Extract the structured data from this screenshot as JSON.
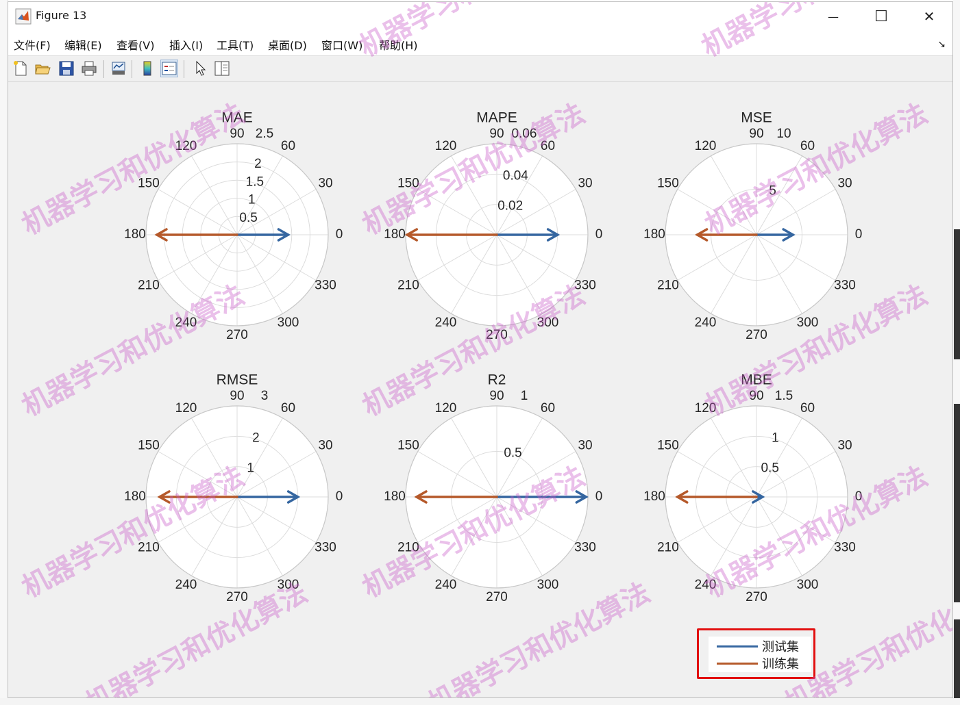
{
  "window": {
    "title": "Figure 13",
    "controls": {
      "minimize": "—",
      "maximize": "☐",
      "close": "✕"
    }
  },
  "menubar": {
    "items": [
      "文件(F)",
      "编辑(E)",
      "查看(V)",
      "插入(I)",
      "工具(T)",
      "桌面(D)",
      "窗口(W)",
      "帮助(H)"
    ],
    "overflow": "↘"
  },
  "toolbar": {
    "buttons": [
      {
        "name": "new-figure",
        "icon": "new-file-icon"
      },
      {
        "name": "open-file",
        "icon": "folder-open-icon"
      },
      {
        "name": "save-figure",
        "icon": "save-icon"
      },
      {
        "name": "print-figure",
        "icon": "printer-icon"
      },
      {
        "name": "link-plot",
        "icon": "link-plot-icon"
      },
      {
        "name": "insert-colorbar",
        "icon": "colorbar-icon"
      },
      {
        "name": "insert-legend",
        "icon": "legend-icon"
      },
      {
        "name": "edit-plot",
        "icon": "cursor-arrow-icon"
      },
      {
        "name": "property-inspector",
        "icon": "panel-icon"
      }
    ]
  },
  "colors": {
    "test": "#3566a0",
    "train": "#b5592a",
    "legend_border": "#e21010"
  },
  "legend": {
    "test_label": "测试集",
    "train_label": "训练集"
  },
  "watermark_text": "机器学习和优化算法",
  "angle_labels": [
    "0",
    "30",
    "60",
    "90",
    "120",
    "150",
    "180",
    "210",
    "240",
    "270",
    "300",
    "330"
  ],
  "chart_data": [
    {
      "type": "polar",
      "title": "MAE",
      "rmax": 2.5,
      "rticks": [
        "0.5",
        "1",
        "1.5",
        "2",
        "2.5"
      ],
      "series": [
        {
          "name": "测试集",
          "theta": 0,
          "r": 1.4
        },
        {
          "name": "训练集",
          "theta": 180,
          "r": 2.2
        }
      ]
    },
    {
      "type": "polar",
      "title": "MAPE",
      "rmax": 0.06,
      "rticks": [
        "0.02",
        "0.04",
        "0.06"
      ],
      "series": [
        {
          "name": "测试集",
          "theta": 0,
          "r": 0.04
        },
        {
          "name": "训练集",
          "theta": 180,
          "r": 0.059
        }
      ]
    },
    {
      "type": "polar",
      "title": "MSE",
      "rmax": 10,
      "rticks": [
        "5",
        "10"
      ],
      "series": [
        {
          "name": "测试集",
          "theta": 0,
          "r": 4.0
        },
        {
          "name": "训练集",
          "theta": 180,
          "r": 6.5
        }
      ]
    },
    {
      "type": "polar",
      "title": "RMSE",
      "rmax": 3,
      "rticks": [
        "1",
        "2",
        "3"
      ],
      "series": [
        {
          "name": "测试集",
          "theta": 0,
          "r": 2.0
        },
        {
          "name": "训练集",
          "theta": 180,
          "r": 2.55
        }
      ]
    },
    {
      "type": "polar",
      "title": "R2",
      "rmax": 1,
      "rticks": [
        "0.5",
        "1"
      ],
      "series": [
        {
          "name": "测试集",
          "theta": 0,
          "r": 0.98
        },
        {
          "name": "训练集",
          "theta": 180,
          "r": 0.88
        }
      ]
    },
    {
      "type": "polar",
      "title": "MBE",
      "rmax": 1.5,
      "rticks": [
        "0.5",
        "1",
        "1.5"
      ],
      "series": [
        {
          "name": "测试集",
          "theta": 0,
          "r": 0.1
        },
        {
          "name": "训练集",
          "theta": 180,
          "r": 1.3
        }
      ]
    }
  ]
}
